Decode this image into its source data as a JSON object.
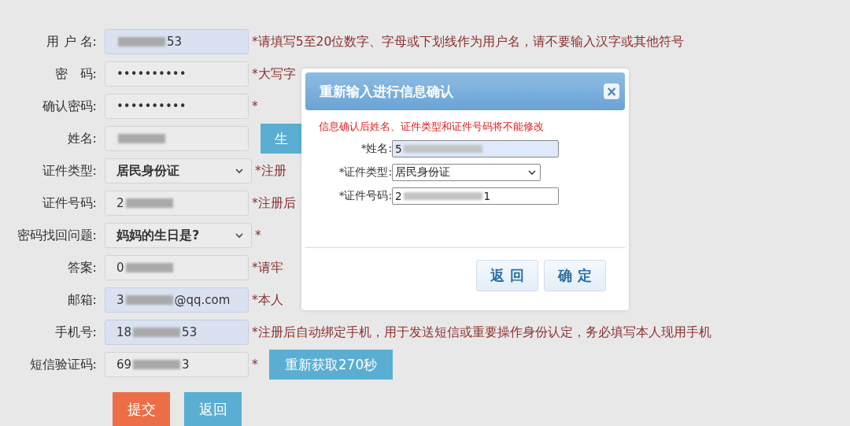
{
  "form": {
    "fields": [
      {
        "label": "用 户 名:",
        "kind": "text",
        "autofilled": true,
        "value_end": "53",
        "masked": true,
        "hint": "*请填写5至20位数字、字母或下划线作为用户名，请不要输入汉字或其他符号"
      },
      {
        "label": "密　码:",
        "kind": "text",
        "autofilled": false,
        "value_start": "••••••••••",
        "masked": false,
        "hint": "*大写字"
      },
      {
        "label": "确认密码:",
        "kind": "text",
        "autofilled": false,
        "value_start": "••••••••••",
        "masked": false,
        "hint": "*"
      },
      {
        "label": "姓名:",
        "kind": "text",
        "autofilled": false,
        "masked": true,
        "side_button": "生"
      },
      {
        "label": "证件类型:",
        "kind": "select",
        "autofilled": false,
        "value_start": "居民身份证",
        "masked": false,
        "hint": "*注册"
      },
      {
        "label": "证件号码:",
        "kind": "text",
        "autofilled": false,
        "value_start": "2",
        "masked": true,
        "hint": "*注册后"
      },
      {
        "label": "密码找回问题:",
        "kind": "select",
        "autofilled": false,
        "value_start": "妈妈的生日是?",
        "masked": false,
        "hint": "*"
      },
      {
        "label": "答案:",
        "kind": "text",
        "autofilled": false,
        "value_start": "0",
        "masked": true,
        "hint": "*请牢"
      },
      {
        "label": "邮箱:",
        "kind": "text",
        "autofilled": true,
        "value_start": "3",
        "value_end": "@qq.com",
        "masked": true,
        "hint": "*本人"
      },
      {
        "label": "手机号:",
        "kind": "text",
        "autofilled": true,
        "value_start": "18",
        "value_end": "53",
        "masked": true,
        "hint": "*注册后自动绑定手机，用于发送短信或重要操作身份认定，务必填写本人现用手机"
      },
      {
        "label": "短信验证码:",
        "kind": "text",
        "autofilled": false,
        "value_start": "69",
        "value_end": "3",
        "masked": true,
        "hint": "*",
        "side_button": "重新获取270秒"
      }
    ],
    "buttons": [
      {
        "label": "提交",
        "kind": "primary"
      },
      {
        "label": "返回",
        "kind": "secondary"
      }
    ]
  },
  "dialog": {
    "title": "重新输入进行信息确认",
    "close": "×",
    "notice": "信息确认后姓名、证件类型和证件号码将不能修改",
    "fields": [
      {
        "label": "*姓名:",
        "kind": "text",
        "autofilled": true,
        "value_start": "5",
        "masked": true
      },
      {
        "label": "*证件类型:",
        "kind": "select",
        "autofilled": false,
        "value_start": "居民身份证",
        "masked": false
      },
      {
        "label": "*证件号码:",
        "kind": "text",
        "autofilled": false,
        "value_start": "2",
        "value_end": "1",
        "masked": true
      }
    ],
    "buttons": [
      {
        "label": "返 回"
      },
      {
        "label": "确 定"
      }
    ]
  }
}
